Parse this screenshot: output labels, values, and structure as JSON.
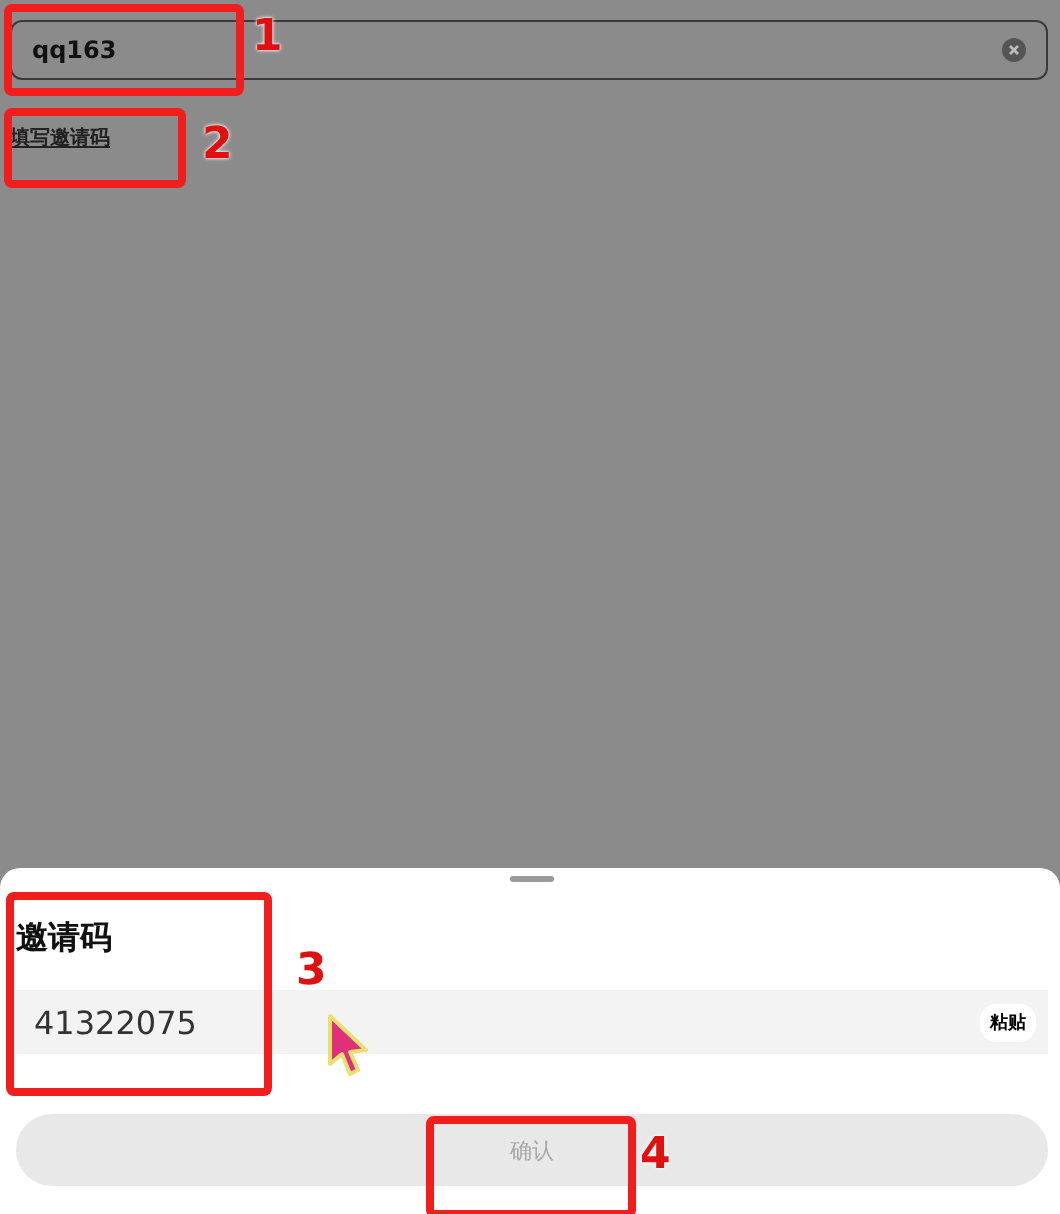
{
  "search_field": {
    "value": "qq163"
  },
  "invite_link": "填写邀请码",
  "sheet": {
    "title": "邀请码",
    "code_field": {
      "value": "41322075"
    },
    "paste_button": "粘贴",
    "confirm_button": {
      "label": "确认",
      "disabled": true
    }
  },
  "annotations": [
    "1",
    "2",
    "3",
    "4"
  ]
}
